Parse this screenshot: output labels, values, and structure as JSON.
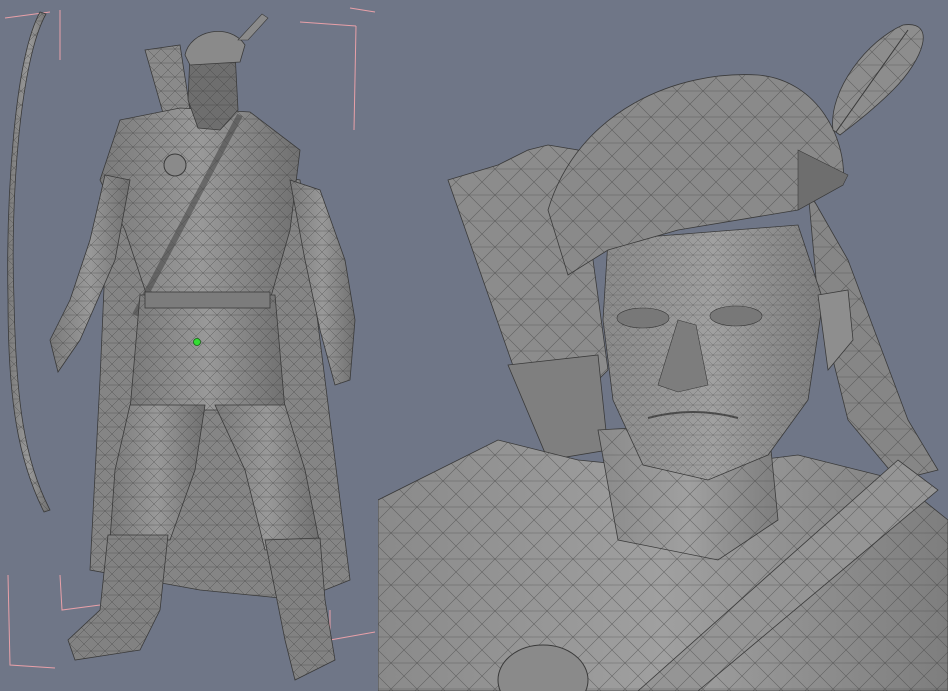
{
  "scene": {
    "background_color": "#6f7687",
    "mesh_color": "#8e8e8e",
    "mesh_shadow_color": "#6a6a6a",
    "wire_color": "#3a3a3a",
    "bbox_color": "#e8a0a8",
    "pivot_color": "#33dd33"
  },
  "viewports": [
    {
      "id": "full-body",
      "subject": "archer-character-full-body"
    },
    {
      "id": "closeup",
      "subject": "archer-character-head-closeup"
    }
  ]
}
